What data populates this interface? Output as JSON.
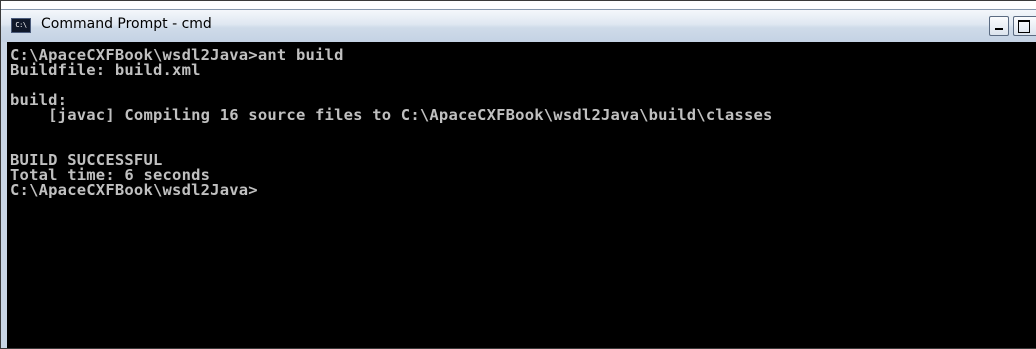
{
  "window": {
    "title": "Command Prompt - cmd",
    "icon": "console-app-icon",
    "icon_text": "C:\\",
    "buttons": [
      "minimize",
      "maximize"
    ]
  },
  "console": {
    "background": "#000000",
    "foreground": "#c0c0c0",
    "lines": [
      "C:\\ApaceCXFBook\\wsdl2Java>ant build",
      "Buildfile: build.xml",
      "",
      "build:",
      "    [javac] Compiling 16 source files to C:\\ApaceCXFBook\\wsdl2Java\\build\\classes",
      "",
      "",
      "BUILD SUCCESSFUL",
      "Total time: 6 seconds",
      "C:\\ApaceCXFBook\\wsdl2Java>",
      "",
      "",
      "",
      "",
      "",
      "",
      "",
      ""
    ]
  }
}
